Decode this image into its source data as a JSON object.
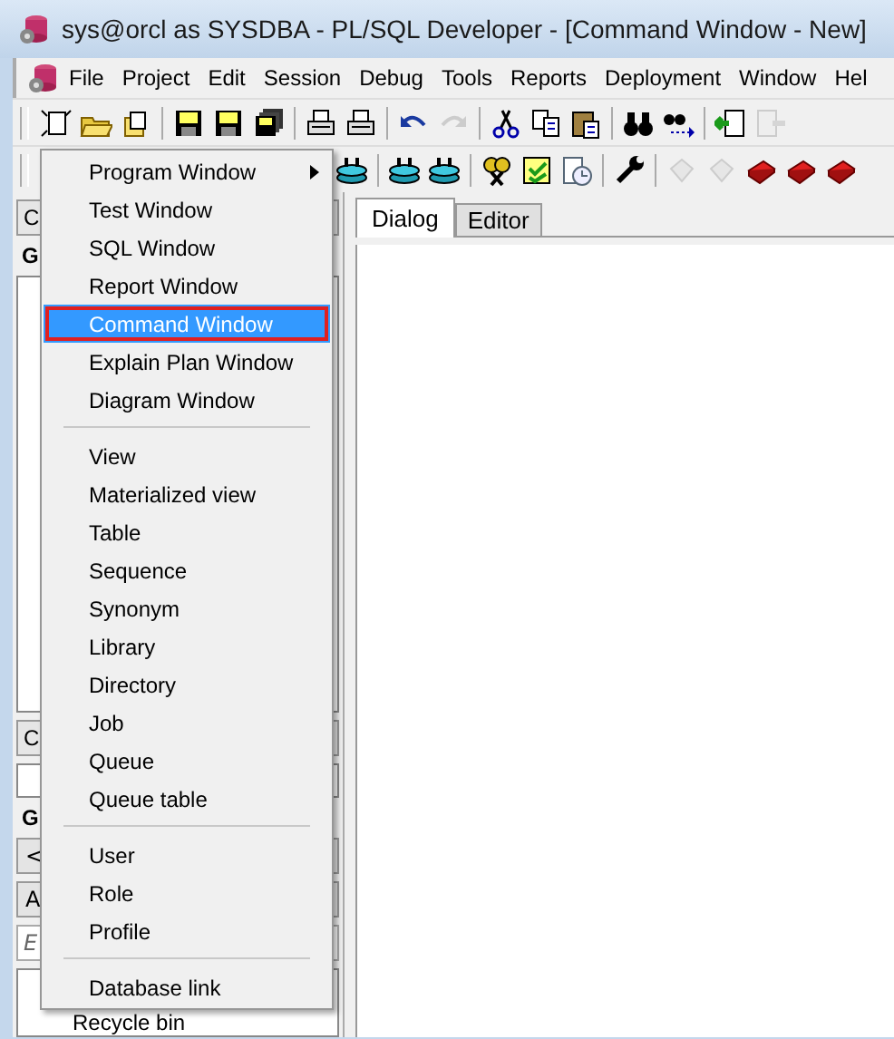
{
  "window": {
    "title": "sys@orcl as SYSDBA - PL/SQL Developer - [Command Window - New]"
  },
  "menubar": [
    "File",
    "Project",
    "Edit",
    "Session",
    "Debug",
    "Tools",
    "Reports",
    "Deployment",
    "Window",
    "Hel"
  ],
  "toolbar_1": [
    {
      "kind": "new",
      "disabled": false
    },
    {
      "kind": "open",
      "disabled": false
    },
    {
      "kind": "print",
      "disabled": false
    },
    {
      "kind": "sep"
    },
    {
      "kind": "save",
      "disabled": false
    },
    {
      "kind": "save",
      "disabled": false
    },
    {
      "kind": "saveall",
      "disabled": false
    },
    {
      "kind": "sep"
    },
    {
      "kind": "printer",
      "disabled": false
    },
    {
      "kind": "printer",
      "disabled": false
    },
    {
      "kind": "sep"
    },
    {
      "kind": "undo",
      "disabled": false
    },
    {
      "kind": "redo",
      "disabled": true
    },
    {
      "kind": "sep"
    },
    {
      "kind": "cut",
      "disabled": false
    },
    {
      "kind": "copy",
      "disabled": false
    },
    {
      "kind": "paste",
      "disabled": false
    },
    {
      "kind": "sep"
    },
    {
      "kind": "find",
      "disabled": false
    },
    {
      "kind": "findnext",
      "disabled": false
    },
    {
      "kind": "sep"
    },
    {
      "kind": "import",
      "disabled": false
    },
    {
      "kind": "export",
      "disabled": true
    }
  ],
  "toolbar_2": [
    {
      "kind": "db",
      "disabled": false
    },
    {
      "kind": "sep"
    },
    {
      "kind": "db",
      "disabled": false
    },
    {
      "kind": "db",
      "disabled": false
    },
    {
      "kind": "sep"
    },
    {
      "kind": "keys",
      "disabled": false
    },
    {
      "kind": "check",
      "disabled": false
    },
    {
      "kind": "doc",
      "disabled": false
    },
    {
      "kind": "sep"
    },
    {
      "kind": "wrench",
      "disabled": false
    },
    {
      "kind": "sep"
    },
    {
      "kind": "gem",
      "disabled": true
    },
    {
      "kind": "gem",
      "disabled": true
    },
    {
      "kind": "book",
      "disabled": false
    },
    {
      "kind": "book",
      "disabled": false
    },
    {
      "kind": "book",
      "disabled": false
    }
  ],
  "left_panel": [
    {
      "kind": "combo",
      "text": "C"
    },
    {
      "kind": "heading",
      "text": "G"
    },
    {
      "kind": "list"
    },
    {
      "kind": "combo",
      "text": "C"
    },
    {
      "kind": "field"
    },
    {
      "kind": "heading",
      "text": "G"
    },
    {
      "kind": "button",
      "text": "<"
    },
    {
      "kind": "button",
      "text": "A"
    },
    {
      "kind": "input",
      "text": "E"
    },
    {
      "kind": "tree",
      "text": "Recycle bin"
    }
  ],
  "tabs": [
    {
      "label": "Dialog",
      "selected": true
    },
    {
      "label": "Editor",
      "selected": false
    }
  ],
  "popup_menu": [
    [
      {
        "label": "Program Window",
        "submenu": true,
        "selected": false
      },
      {
        "label": "Test Window",
        "submenu": false,
        "selected": false
      },
      {
        "label": "SQL Window",
        "submenu": false,
        "selected": false
      },
      {
        "label": "Report Window",
        "submenu": false,
        "selected": false
      },
      {
        "label": "Command Window",
        "submenu": false,
        "selected": true
      },
      {
        "label": "Explain Plan Window",
        "submenu": false,
        "selected": false
      },
      {
        "label": "Diagram Window",
        "submenu": false,
        "selected": false
      }
    ],
    [
      {
        "label": "View",
        "submenu": false,
        "selected": false
      },
      {
        "label": "Materialized view",
        "submenu": false,
        "selected": false
      },
      {
        "label": "Table",
        "submenu": false,
        "selected": false
      },
      {
        "label": "Sequence",
        "submenu": false,
        "selected": false
      },
      {
        "label": "Synonym",
        "submenu": false,
        "selected": false
      },
      {
        "label": "Library",
        "submenu": false,
        "selected": false
      },
      {
        "label": "Directory",
        "submenu": false,
        "selected": false
      },
      {
        "label": "Job",
        "submenu": false,
        "selected": false
      },
      {
        "label": "Queue",
        "submenu": false,
        "selected": false
      },
      {
        "label": "Queue table",
        "submenu": false,
        "selected": false
      }
    ],
    [
      {
        "label": "User",
        "submenu": false,
        "selected": false
      },
      {
        "label": "Role",
        "submenu": false,
        "selected": false
      },
      {
        "label": "Profile",
        "submenu": false,
        "selected": false
      }
    ],
    [
      {
        "label": "Database link",
        "submenu": false,
        "selected": false
      }
    ]
  ]
}
